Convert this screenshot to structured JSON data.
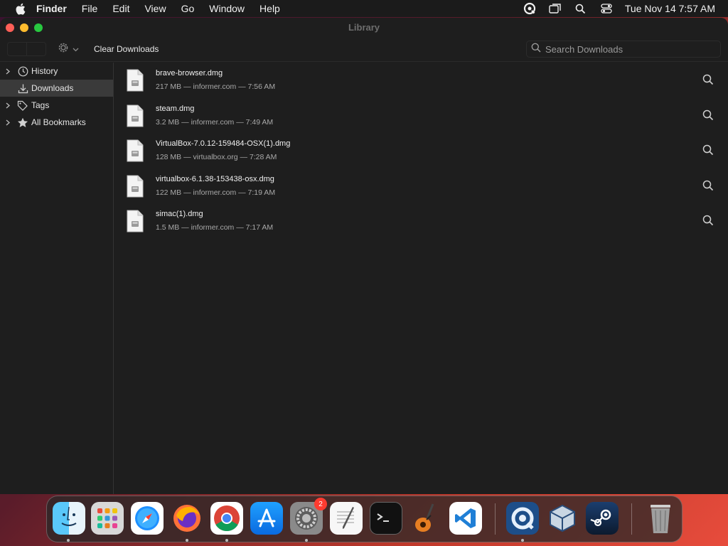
{
  "menubar": {
    "app_name": "Finder",
    "items": [
      "File",
      "Edit",
      "View",
      "Go",
      "Window",
      "Help"
    ],
    "clock": "Tue Nov 14  7:57 AM"
  },
  "window": {
    "title": "Library"
  },
  "toolbar": {
    "clear_label": "Clear Downloads",
    "search_placeholder": "Search Downloads"
  },
  "sidebar": {
    "items": [
      {
        "label": "History",
        "icon": "clock-icon",
        "expandable": true,
        "selected": false
      },
      {
        "label": "Downloads",
        "icon": "download-icon",
        "expandable": false,
        "selected": true
      },
      {
        "label": "Tags",
        "icon": "tag-icon",
        "expandable": true,
        "selected": false
      },
      {
        "label": "All Bookmarks",
        "icon": "star-icon",
        "expandable": true,
        "selected": false
      }
    ]
  },
  "downloads": [
    {
      "name": "brave-browser.dmg",
      "meta": "217 MB — informer.com — 7:56 AM"
    },
    {
      "name": "steam.dmg",
      "meta": "3.2 MB — informer.com — 7:49 AM"
    },
    {
      "name": "VirtualBox-7.0.12-159484-OSX(1).dmg",
      "meta": "128 MB — virtualbox.org — 7:28 AM"
    },
    {
      "name": "virtualbox-6.1.38-153438-osx.dmg",
      "meta": "122 MB — informer.com — 7:19 AM"
    },
    {
      "name": "simac(1).dmg",
      "meta": "1.5 MB — informer.com — 7:17 AM"
    }
  ],
  "dock": {
    "apps": [
      {
        "name": "finder-icon",
        "running": true
      },
      {
        "name": "launchpad-icon",
        "running": false
      },
      {
        "name": "safari-icon",
        "running": false
      },
      {
        "name": "firefox-icon",
        "running": true
      },
      {
        "name": "chrome-icon",
        "running": true
      },
      {
        "name": "app-store-icon",
        "running": false
      },
      {
        "name": "system-settings-icon",
        "running": true,
        "badge": "2"
      },
      {
        "name": "textedit-icon",
        "running": false
      },
      {
        "name": "terminal-icon",
        "running": false
      },
      {
        "name": "garageband-icon",
        "running": false
      },
      {
        "name": "vscode-icon",
        "running": false
      },
      {
        "name": "quicktime-icon",
        "running": true
      },
      {
        "name": "virtualbox-icon",
        "running": false
      },
      {
        "name": "steam-icon",
        "running": false
      },
      {
        "name": "trash-icon",
        "running": false
      }
    ]
  },
  "colors": {
    "window_bg": "#1e1e1e",
    "close": "#ff5f57",
    "minimize": "#febc2e",
    "zoom": "#28c840",
    "badge": "#ff3b30"
  }
}
